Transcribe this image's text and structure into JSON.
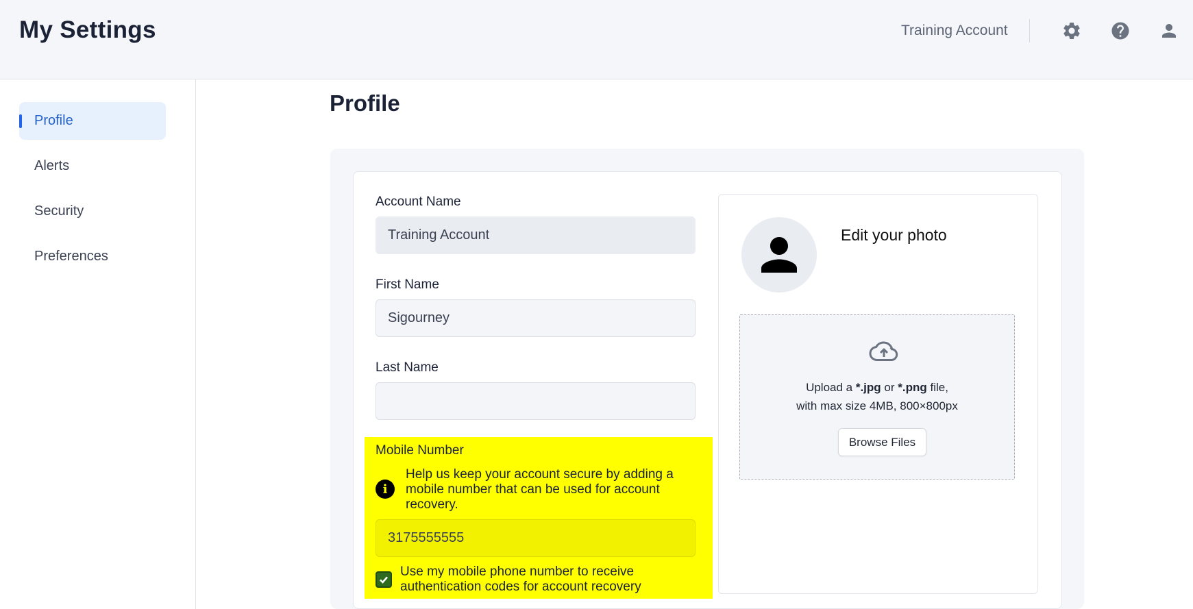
{
  "header": {
    "title": "My Settings",
    "account_name": "Training Account",
    "icons": [
      "gear-icon",
      "help-icon",
      "user-icon"
    ]
  },
  "sidebar": {
    "items": [
      {
        "label": "Profile",
        "active": true
      },
      {
        "label": "Alerts",
        "active": false
      },
      {
        "label": "Security",
        "active": false
      },
      {
        "label": "Preferences",
        "active": false
      }
    ]
  },
  "main": {
    "page_title": "Profile",
    "form": {
      "account_name_label": "Account Name",
      "account_name_value": "Training Account",
      "first_name_label": "First Name",
      "first_name_value": "Sigourney",
      "last_name_label": "Last Name",
      "last_name_value": "",
      "mobile_label": "Mobile Number",
      "mobile_info": "Help us keep your account secure by adding a mobile number that can be used for account recovery.",
      "mobile_value": "3175555555",
      "mfa_checkbox_label": "Use my mobile phone number to receive authentication codes for account recovery",
      "mfa_checked": true
    },
    "photo": {
      "title": "Edit your photo",
      "upload_prefix": "Upload a ",
      "jpg": "*.jpg",
      "or": " or ",
      "png": "*.png",
      "upload_suffix": " file,",
      "upload_line2": "with max size 4MB, 800×800px",
      "browse_label": "Browse Files"
    }
  },
  "colors": {
    "accent": "#2563eb",
    "highlight": "#ffff00",
    "checkbox": "#2f6b1f"
  }
}
